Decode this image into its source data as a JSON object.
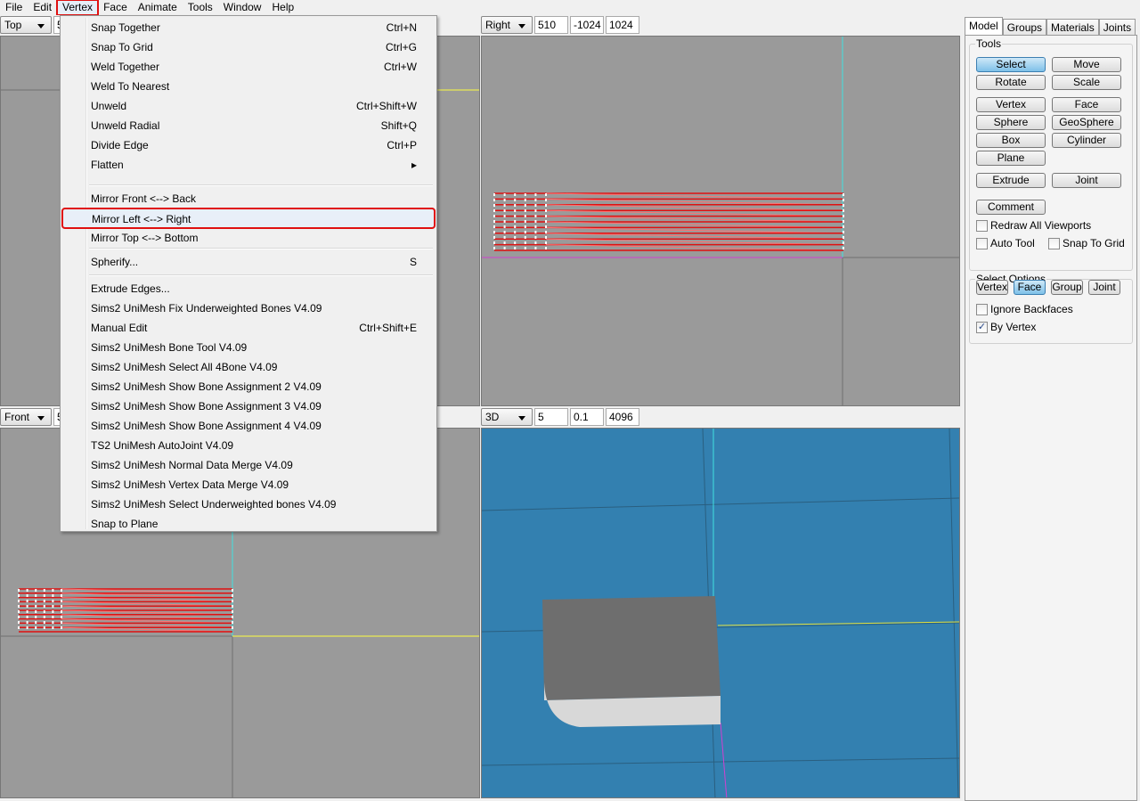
{
  "menubar": {
    "items": [
      "File",
      "Edit",
      "Vertex",
      "Face",
      "Animate",
      "Tools",
      "Window",
      "Help"
    ],
    "open": "Vertex"
  },
  "vertex_menu": [
    {
      "label": "Snap Together",
      "shortcut": "Ctrl+N"
    },
    {
      "label": "Snap To Grid",
      "shortcut": "Ctrl+G"
    },
    {
      "label": "Weld Together",
      "shortcut": "Ctrl+W"
    },
    {
      "label": "Weld To Nearest",
      "shortcut": ""
    },
    {
      "label": "Unweld",
      "shortcut": "Ctrl+Shift+W"
    },
    {
      "label": "Unweld Radial",
      "shortcut": "Shift+Q"
    },
    {
      "label": "Divide Edge",
      "shortcut": "Ctrl+P"
    },
    {
      "label": "Flatten",
      "shortcut": "▸"
    },
    {
      "label": "Mirror Front <--> Back",
      "shortcut": ""
    },
    {
      "label": "Mirror Left <--> Right",
      "shortcut": "",
      "highlighted": true
    },
    {
      "label": "Mirror Top <--> Bottom",
      "shortcut": ""
    },
    {
      "label": "Spherify...",
      "shortcut": "S"
    },
    {
      "label": "Extrude Edges...",
      "shortcut": ""
    },
    {
      "label": "Sims2 UniMesh Fix Underweighted Bones V4.09",
      "shortcut": ""
    },
    {
      "label": "Manual Edit",
      "shortcut": "Ctrl+Shift+E"
    },
    {
      "label": "Sims2 UniMesh Bone Tool V4.09",
      "shortcut": ""
    },
    {
      "label": "Sims2 UniMesh Select All 4Bone V4.09",
      "shortcut": ""
    },
    {
      "label": "Sims2 UniMesh Show Bone Assignment 2 V4.09",
      "shortcut": ""
    },
    {
      "label": "Sims2 UniMesh Show Bone Assignment 3 V4.09",
      "shortcut": ""
    },
    {
      "label": "Sims2 UniMesh Show Bone Assignment 4 V4.09",
      "shortcut": ""
    },
    {
      "label": "TS2 UniMesh AutoJoint V4.09",
      "shortcut": ""
    },
    {
      "label": "Sims2 UniMesh Normal Data Merge V4.09",
      "shortcut": ""
    },
    {
      "label": "Sims2 UniMesh Vertex Data Merge V4.09",
      "shortcut": ""
    },
    {
      "label": "Sims2 UniMesh Select Underweighted bones V4.09",
      "shortcut": ""
    },
    {
      "label": "Snap to Plane",
      "shortcut": ""
    }
  ],
  "viewports": {
    "top": {
      "view": "Top",
      "v1": "5"
    },
    "right": {
      "view": "Right",
      "v1": "510",
      "v2": "-1024",
      "v3": "1024"
    },
    "front": {
      "view": "Front",
      "v1": "5"
    },
    "three_d": {
      "view": "3D",
      "v1": "5",
      "v2": "0.1",
      "v3": "4096"
    }
  },
  "panel": {
    "tabs": [
      "Model",
      "Groups",
      "Materials",
      "Joints"
    ],
    "active_tab": "Model",
    "tools_label": "Tools",
    "tools": [
      "Select",
      "Move",
      "Rotate",
      "Scale",
      "Vertex",
      "Face",
      "Sphere",
      "GeoSphere",
      "Box",
      "Cylinder",
      "Plane",
      "Extrude",
      "Joint",
      "Comment"
    ],
    "active_tool": "Select",
    "redraw_all": {
      "label": "Redraw All Viewports",
      "checked": false
    },
    "auto_tool": {
      "label": "Auto Tool",
      "checked": false
    },
    "snap_grid": {
      "label": "Snap To Grid",
      "checked": false
    },
    "select_options_label": "Select Options",
    "select_modes": [
      "Vertex",
      "Face",
      "Group",
      "Joint"
    ],
    "active_select_mode": "Face",
    "ignore_backfaces": {
      "label": "Ignore Backfaces",
      "checked": false
    },
    "by_vertex": {
      "label": "By Vertex",
      "checked": true,
      "mark": "✓"
    }
  },
  "colors": {
    "viewport_bg": "#9a9a9a",
    "view3d_bg": "#3380b0",
    "mesh": "#e01010",
    "highlight": "#e01010"
  }
}
